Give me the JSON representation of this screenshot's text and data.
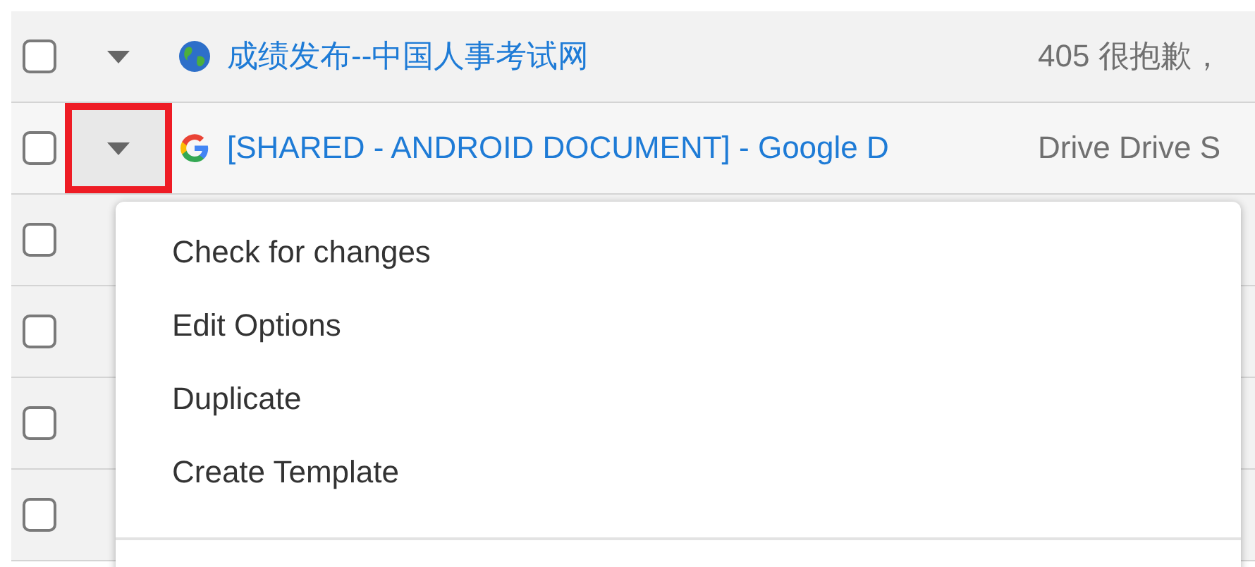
{
  "rows": [
    {
      "checked": false,
      "highlighted": false,
      "kind": "web",
      "title": "成绩发布--中国人事考试网",
      "snippet": "405 很抱歉，"
    },
    {
      "checked": false,
      "highlighted": true,
      "kind": "google",
      "title": "[SHARED - ANDROID DOCUMENT] - Google D",
      "snippet": "Drive Drive S"
    },
    {
      "checked": false,
      "kind": "covered"
    },
    {
      "checked": false,
      "kind": "covered"
    },
    {
      "checked": false,
      "kind": "covered"
    },
    {
      "checked": false,
      "kind": "covered"
    }
  ],
  "menu": {
    "items": [
      "Check for changes",
      "Edit Options",
      "Duplicate",
      "Create Template"
    ]
  }
}
